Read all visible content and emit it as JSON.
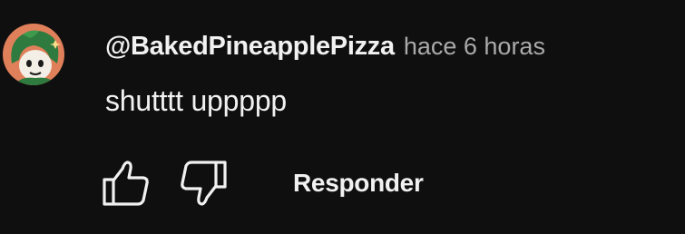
{
  "comment": {
    "author": "@BakedPineapplePizza",
    "timestamp": "hace 6 horas",
    "text": "shutttt uppppp",
    "reply_label": "Responder",
    "avatar": {
      "icon": "user-avatar-green-hair-character",
      "background": "#e0805a"
    },
    "like_icon": "thumbs-up-icon",
    "dislike_icon": "thumbs-down-icon"
  },
  "colors": {
    "background": "#0f0f0f",
    "primary_text": "#f1f1f1",
    "secondary_text": "#aaaaaa"
  }
}
